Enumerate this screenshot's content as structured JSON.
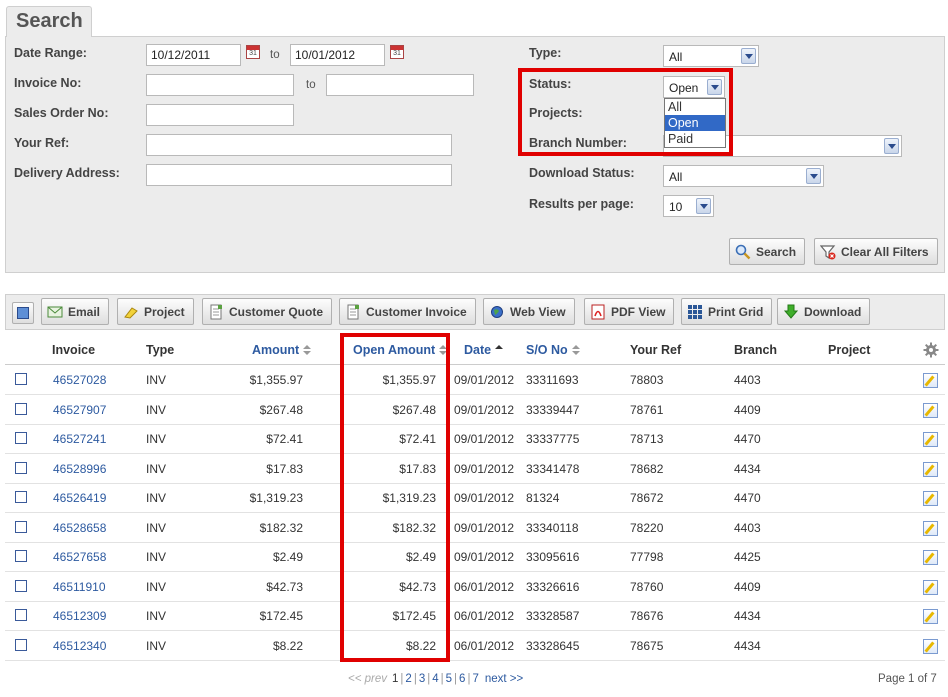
{
  "search": {
    "tab_label": "Search",
    "date_range_label": "Date Range:",
    "date_from": "10/12/2011",
    "date_to": "10/01/2012",
    "to_label": "to",
    "invoice_no_label": "Invoice No:",
    "sales_order_label": "Sales Order No:",
    "your_ref_label": "Your Ref:",
    "delivery_address_label": "Delivery Address:",
    "type_label": "Type:",
    "type_value": "All",
    "status_label": "Status:",
    "status_value": "Open",
    "status_options": [
      "All",
      "Open",
      "Paid"
    ],
    "projects_label": "Projects:",
    "branch_label": "Branch Number:",
    "download_status_label": "Download Status:",
    "download_status_value": "All",
    "results_label": "Results per page:",
    "results_value": "10",
    "search_button": "Search",
    "clear_button": "Clear All Filters",
    "cal_num": "31"
  },
  "toolbar": {
    "email": "Email",
    "project": "Project",
    "customer_quote": "Customer Quote",
    "customer_invoice": "Customer Invoice",
    "web_view": "Web View",
    "pdf_view": "PDF View",
    "print_grid": "Print Grid",
    "download": "Download"
  },
  "table": {
    "headers": {
      "invoice": "Invoice",
      "type": "Type",
      "amount": "Amount",
      "open_amount": "Open Amount",
      "date": "Date",
      "so_no": "S/O No",
      "your_ref": "Your Ref",
      "branch": "Branch",
      "project": "Project"
    },
    "rows": [
      {
        "invoice": "46527028",
        "type": "INV",
        "amount": "$1,355.97",
        "open": "$1,355.97",
        "date": "09/01/2012",
        "so": "33311693",
        "ref": "78803",
        "branch": "4403"
      },
      {
        "invoice": "46527907",
        "type": "INV",
        "amount": "$267.48",
        "open": "$267.48",
        "date": "09/01/2012",
        "so": "33339447",
        "ref": "78761",
        "branch": "4409"
      },
      {
        "invoice": "46527241",
        "type": "INV",
        "amount": "$72.41",
        "open": "$72.41",
        "date": "09/01/2012",
        "so": "33337775",
        "ref": "78713",
        "branch": "4470"
      },
      {
        "invoice": "46528996",
        "type": "INV",
        "amount": "$17.83",
        "open": "$17.83",
        "date": "09/01/2012",
        "so": "33341478",
        "ref": "78682",
        "branch": "4434"
      },
      {
        "invoice": "46526419",
        "type": "INV",
        "amount": "$1,319.23",
        "open": "$1,319.23",
        "date": "09/01/2012",
        "so": "81324",
        "ref": "78672",
        "branch": "4470"
      },
      {
        "invoice": "46528658",
        "type": "INV",
        "amount": "$182.32",
        "open": "$182.32",
        "date": "09/01/2012",
        "so": "33340118",
        "ref": "78220",
        "branch": "4403"
      },
      {
        "invoice": "46527658",
        "type": "INV",
        "amount": "$2.49",
        "open": "$2.49",
        "date": "09/01/2012",
        "so": "33095616",
        "ref": "77798",
        "branch": "4425"
      },
      {
        "invoice": "46511910",
        "type": "INV",
        "amount": "$42.73",
        "open": "$42.73",
        "date": "06/01/2012",
        "so": "33326616",
        "ref": "78760",
        "branch": "4409"
      },
      {
        "invoice": "46512309",
        "type": "INV",
        "amount": "$172.45",
        "open": "$172.45",
        "date": "06/01/2012",
        "so": "33328587",
        "ref": "78676",
        "branch": "4434"
      },
      {
        "invoice": "46512340",
        "type": "INV",
        "amount": "$8.22",
        "open": "$8.22",
        "date": "06/01/2012",
        "so": "33328645",
        "ref": "78675",
        "branch": "4434"
      }
    ]
  },
  "pager": {
    "prev": "<< prev",
    "pages": [
      "1",
      "2",
      "3",
      "4",
      "5",
      "6",
      "7"
    ],
    "next": "next >>",
    "page_info": "Page 1 of 7"
  },
  "colors": {
    "link": "#2d5aa0",
    "highlight": "#e00000",
    "selected_option": "#3169c6"
  }
}
